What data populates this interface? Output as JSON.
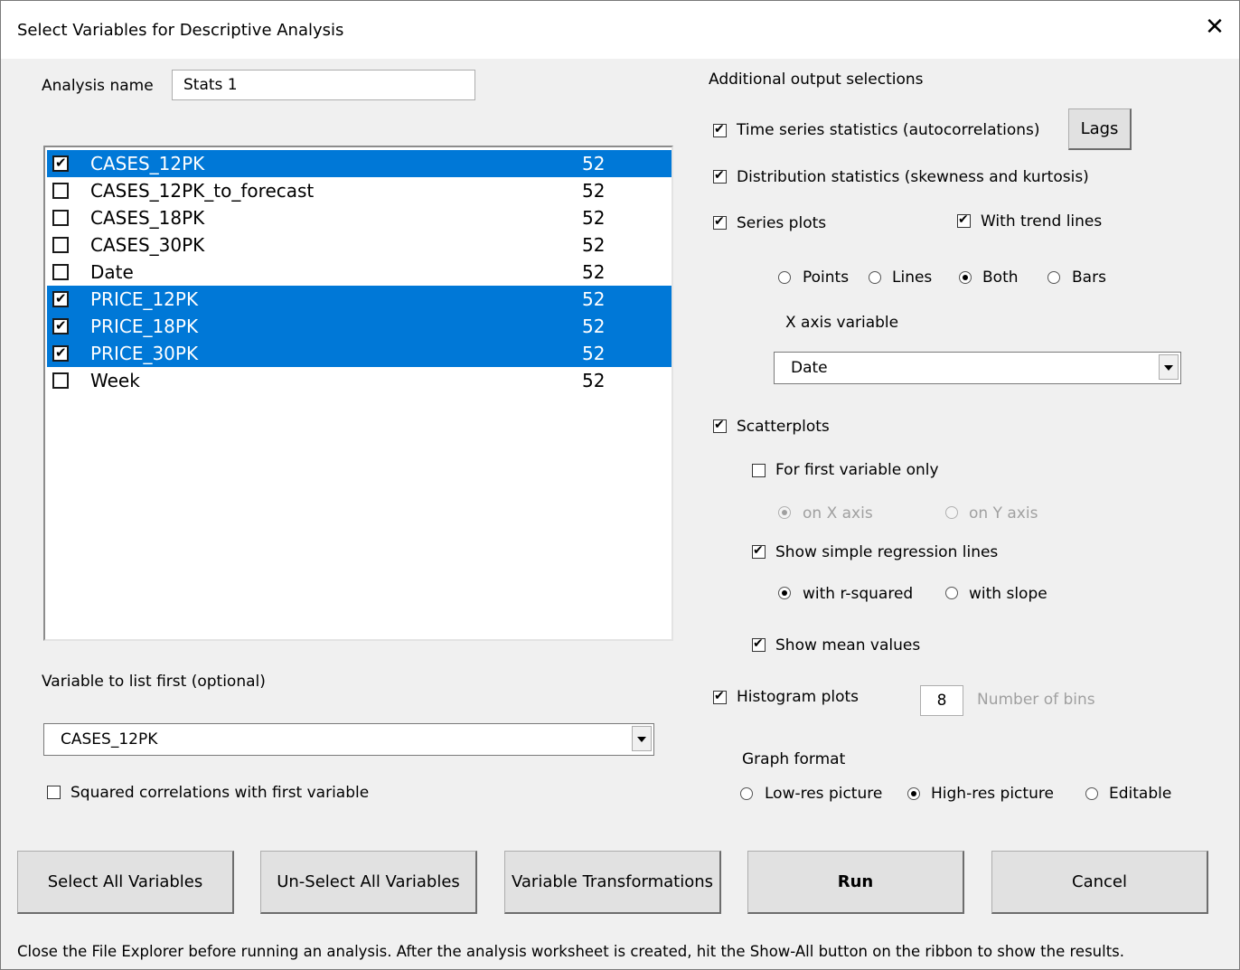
{
  "dialog": {
    "title": "Select Variables for Descriptive Analysis"
  },
  "analysis_name": {
    "label": "Analysis name",
    "value": "Stats 1"
  },
  "variables": [
    {
      "name": "CASES_12PK",
      "count": "52",
      "checked": true
    },
    {
      "name": "CASES_12PK_to_forecast",
      "count": "52",
      "checked": false
    },
    {
      "name": "CASES_18PK",
      "count": "52",
      "checked": false
    },
    {
      "name": "CASES_30PK",
      "count": "52",
      "checked": false
    },
    {
      "name": "Date",
      "count": "52",
      "checked": false
    },
    {
      "name": "PRICE_12PK",
      "count": "52",
      "checked": true
    },
    {
      "name": "PRICE_18PK",
      "count": "52",
      "checked": true
    },
    {
      "name": "PRICE_30PK",
      "count": "52",
      "checked": true
    },
    {
      "name": "Week",
      "count": "52",
      "checked": false
    }
  ],
  "first_variable": {
    "label": "Variable to list first (optional)",
    "value": "CASES_12PK"
  },
  "squared_correlations": {
    "label": "Squared correlations with first variable",
    "checked": false
  },
  "output": {
    "heading": "Additional output selections",
    "time_series": {
      "label": "Time series statistics (autocorrelations)",
      "checked": true
    },
    "lags_button": "Lags",
    "distribution": {
      "label": "Distribution statistics (skewness and kurtosis)",
      "checked": true
    },
    "series_plots": {
      "label": "Series plots",
      "checked": true
    },
    "trend_lines": {
      "label": "With trend lines",
      "checked": true
    },
    "plot_styles": {
      "points": "Points",
      "lines": "Lines",
      "both": "Both",
      "bars": "Bars",
      "selected": "Both"
    },
    "x_axis": {
      "label": "X axis variable",
      "value": "Date"
    },
    "scatterplots": {
      "label": "Scatterplots",
      "checked": true
    },
    "first_only": {
      "label": "For first variable only",
      "checked": false
    },
    "on_x": "on X axis",
    "on_y": "on Y axis",
    "regression_lines": {
      "label": "Show simple regression lines",
      "checked": true
    },
    "with_r_squared": "with r-squared",
    "with_slope": "with slope",
    "mean_values": {
      "label": "Show mean values",
      "checked": true
    },
    "histogram": {
      "label": "Histogram plots",
      "checked": true
    },
    "bins": {
      "value": "8",
      "label": "Number of bins"
    },
    "graph_format": {
      "label": "Graph format",
      "low_res": "Low-res picture",
      "high_res": "High-res picture",
      "editable": "Editable",
      "selected": "High-res picture"
    }
  },
  "buttons": {
    "select_all": "Select All Variables",
    "unselect_all": "Un-Select All Variables",
    "transformations": "Variable Transformations",
    "run": "Run",
    "cancel": "Cancel"
  },
  "footer_note": "Close the File Explorer before running an analysis.  After the analysis worksheet is created, hit the Show-All button on the ribbon to show the results."
}
